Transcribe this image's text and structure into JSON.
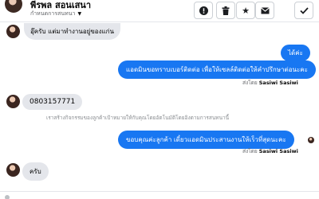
{
  "header": {
    "name": "พีรพล สอนเสนา",
    "status": "กำหนดการสนทนา",
    "actions": [
      {
        "name": "report-button",
        "icon": "alert-icon"
      },
      {
        "name": "delete-button",
        "icon": "trash-icon"
      },
      {
        "name": "star-button",
        "icon": "star-icon"
      },
      {
        "name": "mark-unread-button",
        "icon": "mail-icon"
      },
      {
        "name": "done-button",
        "icon": "check-icon"
      }
    ]
  },
  "messages": {
    "m1": "อุ๊ครับ แต่มาทำงานอยู่ของแก่น",
    "m2": "ได้ค่ะ",
    "m3": "แอดมินขอทราบเบอร์ติดต่อ เพื่อให้เซลล์ติดต่อให้คำปรึกษาต่อนะคะ",
    "m4": "0803157771",
    "m5": "ขอบคุณค่ะลูกค้า เดี๋ยวแอดมินประสานงานให้เร็วที่สุดนะคะ",
    "m6": "ครับ"
  },
  "sent_by": {
    "prefix": "ส่งโดย",
    "agent": "Sasiwi Sasiwi"
  },
  "system_note": "เราสร้างกิจกรรมของลูกค้าเป้าหมายให้กับคุณโดยอัตโนมัติโดยอิงตามการสนทนานี้",
  "colors": {
    "outgoing": "#1877f2",
    "incoming": "#e4e6eb",
    "secondary_text": "#65676b"
  }
}
